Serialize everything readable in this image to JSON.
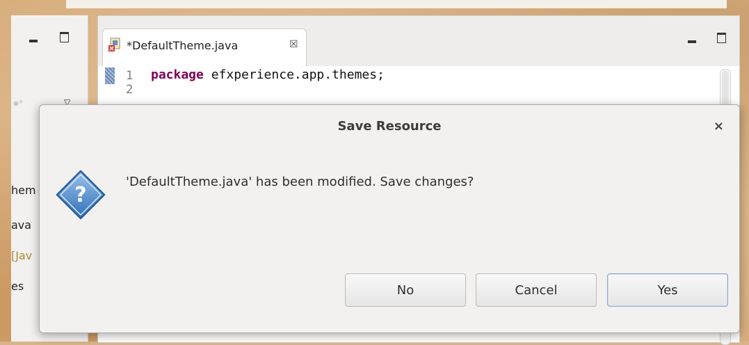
{
  "editor": {
    "tab_title": "*DefaultTheme.java",
    "tab_close_glyph": "☒",
    "lines": [
      {
        "no": "1",
        "keyword": "package",
        "rest": " efxperience.app.themes;"
      },
      {
        "no": "2",
        "keyword": "",
        "rest": ""
      }
    ]
  },
  "left_panel": {
    "items": [
      "hem",
      "ava",
      "[Jav",
      "es"
    ]
  },
  "dialog": {
    "title": "Save Resource",
    "close_glyph": "×",
    "message": "'DefaultTheme.java' has been modified. Save changes?",
    "buttons": {
      "no": "No",
      "cancel": "Cancel",
      "yes": "Yes"
    }
  },
  "icons": {
    "question": "question-icon",
    "java_file": "java-file-icon",
    "minimize": "minimize-icon",
    "maximize": "maximize-icon",
    "view_menu": "chevron-down-icon"
  },
  "colors": {
    "keyword": "#7f0055",
    "question_icon": "#3f7fc8",
    "default_button_border": "#8fa9cf"
  }
}
